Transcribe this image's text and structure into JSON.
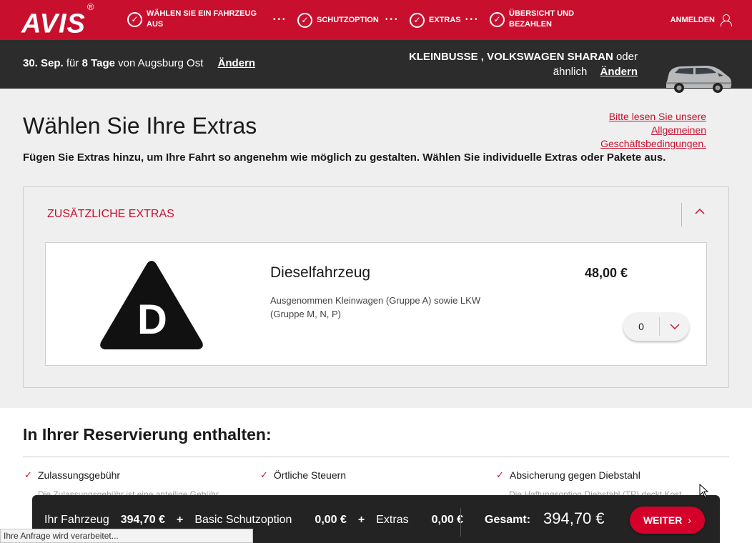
{
  "brand": {
    "logo": "AVIS",
    "reg": "®"
  },
  "steps": [
    {
      "label": "WÄHLEN SIE EIN FAHRZEUG AUS"
    },
    {
      "label": "SCHUTZOPTION"
    },
    {
      "label": "EXTRAS"
    },
    {
      "label": "ÜBERSICHT UND BEZAHLEN"
    }
  ],
  "nav": {
    "login": "ANMELDEN"
  },
  "booking": {
    "date": "30. Sep.",
    "for_text": "für",
    "duration": "8 Tage",
    "from_text": "von",
    "location": "Augsburg Ost",
    "change": "Ändern",
    "vehicle": "KLEINBUSSE , VOLKSWAGEN SHARAN",
    "vehicle_suffix": "oder",
    "similar": "ähnlich",
    "vehicle_change": "Ändern"
  },
  "page": {
    "title": "Wählen Sie Ihre Extras",
    "terms": "Bitte lesen Sie unsere Allgemeinen Geschäftsbedingungen.",
    "subtitle": "Fügen Sie Extras hinzu, um Ihre Fahrt so angenehm wie möglich zu gestalten. Wählen Sie individuelle Extras oder Pakete aus."
  },
  "extras_panel": {
    "title": "ZUSÄTZLICHE EXTRAS",
    "item": {
      "icon_letter": "D",
      "name": "Dieselfahrzeug",
      "description": "Ausgenommen Kleinwagen (Gruppe A) sowie LKW (Gruppe M, N, P)",
      "price": "48,00 €",
      "quantity": "0"
    }
  },
  "included": {
    "title": "In Ihrer Reservierung enthalten:",
    "items": [
      {
        "label": "Zulassungsgebühr",
        "desc": "Die Zulassungsgebühr ist eine anteilige Gebühr"
      },
      {
        "label": "Örtliche Steuern",
        "desc": ""
      },
      {
        "label": "Absicherung gegen Diebstahl",
        "desc": "Die Haftungsoption Diebstahl (TP) deckt Kost"
      }
    ]
  },
  "summary": {
    "vehicle_label": "Ihr Fahrzeug",
    "vehicle_price": "394,70 €",
    "plus": "+",
    "protection_label": "Basic Schutzoption",
    "protection_price": "0,00 €",
    "extras_label": "Extras",
    "extras_price": "0,00 €",
    "total_label": "Gesamt:",
    "total_value": "394,70 €",
    "next_button": "WEITER"
  },
  "status": {
    "text": "Ihre Anfrage wird verarbeitet..."
  },
  "colors": {
    "brand_red": "#c8102e",
    "dark_bar": "#2c2c2c",
    "summary_bg": "#232323"
  }
}
